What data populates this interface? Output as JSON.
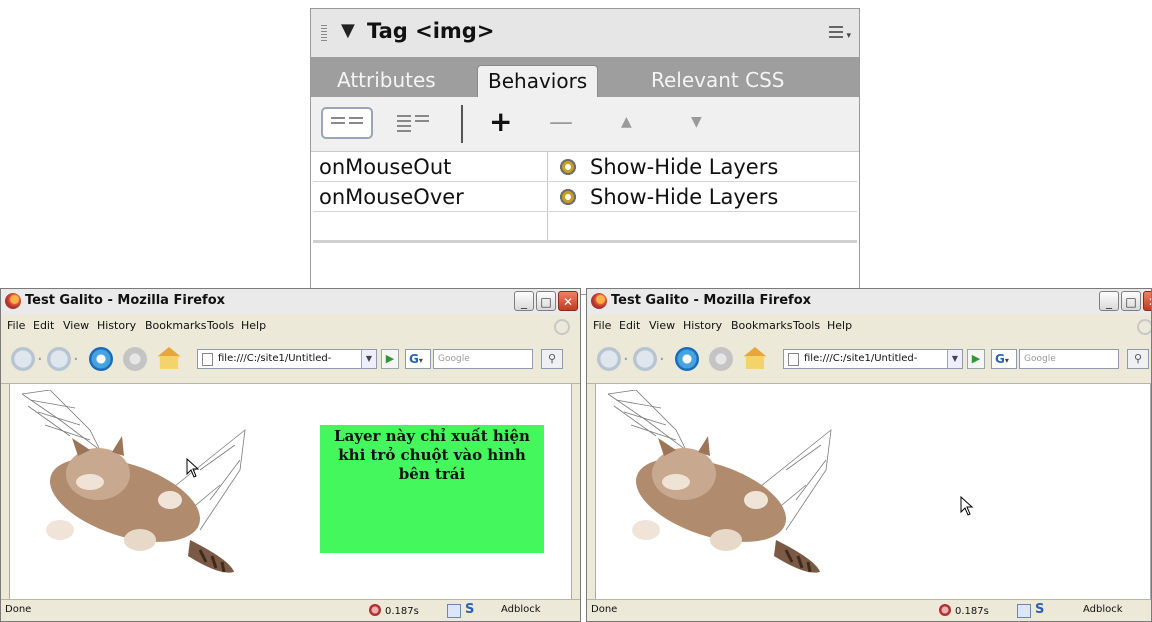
{
  "panel": {
    "title": "Tag <img>",
    "tabs": [
      "Attributes",
      "Behaviors",
      "Relevant CSS"
    ],
    "active_tab": "Behaviors",
    "toolbar_icons": [
      "show-set-events-icon",
      "show-all-events-icon",
      "add-behavior-icon",
      "remove-behavior-icon",
      "move-up-icon",
      "move-down-icon"
    ],
    "toolbar_glyphs": {
      "add": "+",
      "remove": "—",
      "up": "▲",
      "down": "▼"
    },
    "behaviors": [
      {
        "event": "onMouseOut",
        "action": "Show-Hide Layers"
      },
      {
        "event": "onMouseOver",
        "action": "Show-Hide Layers"
      }
    ]
  },
  "browser_windows": [
    {
      "title": "Test Galito - Mozilla Firefox",
      "menu": [
        "File",
        "Edit",
        "View",
        "History",
        "Bookmarks",
        "Tools",
        "Help"
      ],
      "url": "file:///C:/site1/Untitled-",
      "search_placeholder": "Google",
      "search_engine_glyph": "G",
      "layer_text": "Layer này chỉ xuất hiện khi trỏ chuột vào hình bên trái",
      "status": {
        "left": "Done",
        "timing": "0.187s",
        "s_label": "S",
        "adblock": "Adblock"
      }
    },
    {
      "title": "Test Galito - Mozilla Firefox",
      "menu": [
        "File",
        "Edit",
        "View",
        "History",
        "Bookmarks",
        "Tools",
        "Help"
      ],
      "url": "file:///C:/site1/Untitled-",
      "search_placeholder": "Google",
      "search_engine_glyph": "G",
      "status": {
        "left": "Done",
        "timing": "0.187s",
        "s_label": "S",
        "adblock": "Adblock"
      }
    }
  ],
  "colors": {
    "layer_green": "#43f75c",
    "xp_chrome": "#ece9d8",
    "tab_bar": "#9e9e9e"
  }
}
